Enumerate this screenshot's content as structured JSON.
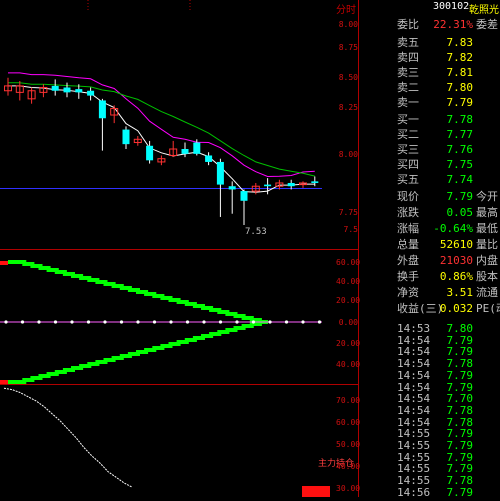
{
  "header": {
    "corner_label": "分时",
    "stock_code": "300102",
    "stock_name": "乾照光"
  },
  "colors": {
    "up": "#ff3232",
    "down": "#00ffff",
    "flat": "#ffffff",
    "label": "#c0c0c0",
    "axis": "#d01010",
    "green": "#00ff00",
    "sell_color": "#ffff00"
  },
  "chart_data": [
    {
      "type": "candlestick",
      "panel": "price",
      "y_ticks": [
        "8.00",
        "8.75",
        "8.50",
        "8.25",
        "8.00",
        "7.75",
        "7.5"
      ],
      "annotations": [
        "7.53"
      ],
      "series": [
        {
          "name": "MA-white",
          "color": "#ffffff"
        },
        {
          "name": "MA-magenta",
          "color": "#ff00ff"
        },
        {
          "name": "MA-green",
          "color": "#00c000"
        },
        {
          "name": "MA-blue",
          "color": "#3030ff"
        }
      ],
      "candles": [
        {
          "o": 8.36,
          "c": 8.39,
          "h": 8.44,
          "l": 8.33
        },
        {
          "o": 8.35,
          "c": 8.39,
          "h": 8.42,
          "l": 8.3
        },
        {
          "o": 8.31,
          "c": 8.36,
          "h": 8.38,
          "l": 8.28
        },
        {
          "o": 8.35,
          "c": 8.38,
          "h": 8.4,
          "l": 8.32
        },
        {
          "o": 8.39,
          "c": 8.36,
          "h": 8.43,
          "l": 8.33
        },
        {
          "o": 8.38,
          "c": 8.35,
          "h": 8.41,
          "l": 8.32
        },
        {
          "o": 8.37,
          "c": 8.35,
          "h": 8.4,
          "l": 8.31
        },
        {
          "o": 8.36,
          "c": 8.33,
          "h": 8.38,
          "l": 8.3
        },
        {
          "o": 8.3,
          "c": 8.19,
          "h": 8.31,
          "l": 7.99
        },
        {
          "o": 8.21,
          "c": 8.25,
          "h": 8.27,
          "l": 8.16
        },
        {
          "o": 8.12,
          "c": 8.03,
          "h": 8.14,
          "l": 8.0
        },
        {
          "o": 8.04,
          "c": 8.06,
          "h": 8.08,
          "l": 8.02
        },
        {
          "o": 8.02,
          "c": 7.93,
          "h": 8.05,
          "l": 7.91
        },
        {
          "o": 7.92,
          "c": 7.94,
          "h": 7.96,
          "l": 7.9
        },
        {
          "o": 7.96,
          "c": 8.0,
          "h": 8.05,
          "l": 7.95
        },
        {
          "o": 8.0,
          "c": 7.97,
          "h": 8.04,
          "l": 7.95
        },
        {
          "o": 8.04,
          "c": 7.97,
          "h": 8.06,
          "l": 7.96
        },
        {
          "o": 7.96,
          "c": 7.92,
          "h": 7.98,
          "l": 7.9
        },
        {
          "o": 7.92,
          "c": 7.78,
          "h": 7.94,
          "l": 7.58
        },
        {
          "o": 7.77,
          "c": 7.75,
          "h": 7.8,
          "l": 7.6
        },
        {
          "o": 7.74,
          "c": 7.68,
          "h": 7.75,
          "l": 7.53
        },
        {
          "o": 7.74,
          "c": 7.77,
          "h": 7.79,
          "l": 7.72
        },
        {
          "o": 7.78,
          "c": 7.77,
          "h": 7.82,
          "l": 7.72
        },
        {
          "o": 7.77,
          "c": 7.79,
          "h": 7.81,
          "l": 7.75
        },
        {
          "o": 7.79,
          "c": 7.77,
          "h": 7.81,
          "l": 7.75
        },
        {
          "o": 7.78,
          "c": 7.79,
          "h": 7.8,
          "l": 7.76
        },
        {
          "o": 7.8,
          "c": 7.79,
          "h": 7.83,
          "l": 7.77
        }
      ]
    },
    {
      "type": "step-line",
      "panel": "indicator",
      "y_ticks": [
        "60.00",
        "40.00",
        "20.00",
        "0.00",
        "20.00",
        "40.00"
      ],
      "series": [
        {
          "name": "upper",
          "color": "#00ff00",
          "values": [
            60,
            60,
            58,
            56,
            54,
            52,
            50,
            48,
            46,
            44,
            42,
            40,
            38,
            36,
            34,
            32,
            30,
            28,
            26,
            24,
            22,
            20,
            18,
            16,
            14,
            12,
            10,
            8,
            6,
            4,
            2,
            0
          ]
        },
        {
          "name": "lower",
          "color": "#00ff00",
          "values": [
            -60,
            -60,
            -58,
            -56,
            -54,
            -52,
            -50,
            -48,
            -46,
            -44,
            -42,
            -40,
            -38,
            -36,
            -34,
            -32,
            -30,
            -28,
            -26,
            -24,
            -22,
            -20,
            -18,
            -16,
            -14,
            -12,
            -10,
            -8,
            -6,
            -4,
            -2,
            0
          ]
        }
      ]
    },
    {
      "type": "line",
      "panel": "bottom",
      "y_ticks": [
        "70.00",
        "60.00",
        "50.00",
        "40.00",
        "30.00"
      ],
      "annotations": [
        "主力持仓"
      ],
      "series": [
        {
          "name": "white-line",
          "color": "#ffffff",
          "values": [
            97,
            96,
            94,
            91,
            88,
            84,
            79,
            74,
            68,
            62,
            55,
            49,
            44,
            38,
            34,
            30,
            27
          ]
        }
      ]
    }
  ],
  "quote": {
    "ratio": {
      "label": "委比",
      "value": "22.31%",
      "ext": "委差"
    },
    "asks": [
      {
        "label": "卖五",
        "price": "7.83",
        "vol": ""
      },
      {
        "label": "卖四",
        "price": "7.82",
        "vol": ""
      },
      {
        "label": "卖三",
        "price": "7.81",
        "vol": ""
      },
      {
        "label": "卖二",
        "price": "7.80",
        "vol": ""
      },
      {
        "label": "卖一",
        "price": "7.79",
        "vol": ""
      }
    ],
    "bids": [
      {
        "label": "买一",
        "price": "7.78",
        "vol": ""
      },
      {
        "label": "买二",
        "price": "7.77",
        "vol": ""
      },
      {
        "label": "买三",
        "price": "7.76",
        "vol": ""
      },
      {
        "label": "买四",
        "price": "7.75",
        "vol": ""
      },
      {
        "label": "买五",
        "price": "7.74",
        "vol": ""
      }
    ],
    "stats": [
      {
        "label": "现价",
        "value": "7.79",
        "ext": "今开"
      },
      {
        "label": "涨跌",
        "value": "0.05",
        "ext": "最高"
      },
      {
        "label": "涨幅",
        "value": "-0.64%",
        "ext": "最低"
      },
      {
        "label": "总量",
        "value": "52610",
        "ext": "量比"
      },
      {
        "label": "外盘",
        "value": "21030",
        "ext": "内盘"
      },
      {
        "label": "换手",
        "value": "0.86%",
        "ext": "股本"
      },
      {
        "label": "净资",
        "value": "3.51",
        "ext": "流通"
      },
      {
        "label": "收益(三)",
        "value": "0.032",
        "ext": "PE(动"
      }
    ],
    "ticks": [
      {
        "time": "14:53",
        "price": "7.80"
      },
      {
        "time": "14:54",
        "price": "7.79"
      },
      {
        "time": "14:54",
        "price": "7.79"
      },
      {
        "time": "14:54",
        "price": "7.78"
      },
      {
        "time": "14:54",
        "price": "7.79"
      },
      {
        "time": "14:54",
        "price": "7.79"
      },
      {
        "time": "14:54",
        "price": "7.70"
      },
      {
        "time": "14:54",
        "price": "7.78"
      },
      {
        "time": "14:54",
        "price": "7.78"
      },
      {
        "time": "14:55",
        "price": "7.79"
      },
      {
        "time": "14:55",
        "price": "7.79"
      },
      {
        "time": "14:55",
        "price": "7.79"
      },
      {
        "time": "14:55",
        "price": "7.79"
      },
      {
        "time": "14:55",
        "price": "7.78"
      },
      {
        "time": "14:56",
        "price": "7.79"
      }
    ]
  }
}
